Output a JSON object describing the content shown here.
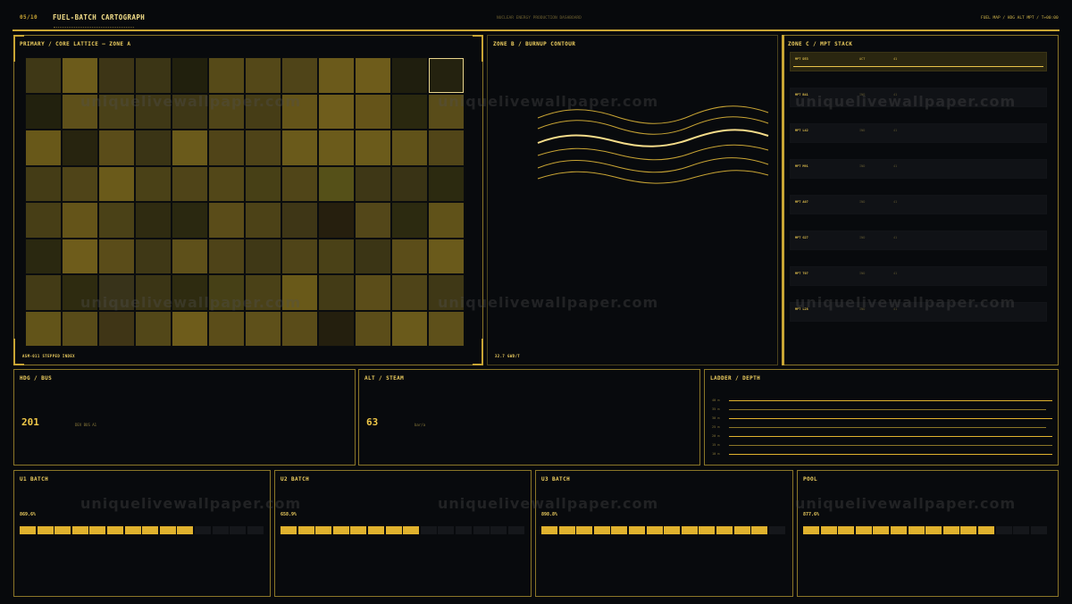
{
  "header": {
    "page_index": "05/10",
    "title": "FUEL-BATCH CARTOGRAPH",
    "subtitle": "NUCLEAR ENERGY PRODUCTION DASHBOARD",
    "right_meta": "FUEL MAP / HDG ALT MPT / T+00:00"
  },
  "zone_a": {
    "title": "PRIMARY / CORE LATTICE — ZONE A",
    "footer": "ASM-011   STEPPED INDEX",
    "cell_shades": [
      "#3f3816",
      "#6c5b1b",
      "#3d3516",
      "#3b3515",
      "#21200d",
      "#564a18",
      "#544818",
      "#4f4418",
      "#6b5a1b",
      "#6e5c1b",
      "#1f1e0e",
      "#24220f",
      "#22210e",
      "#5e501a",
      "#4a4118",
      "#3f3816",
      "#3e3716",
      "#504518",
      "#463d16",
      "#645419",
      "#6f5d1c",
      "#655419",
      "#2a280f",
      "#594c19",
      "#685819",
      "#27240f",
      "#5a4c19",
      "#3a3415",
      "#6a5a1b",
      "#504418",
      "#4e4318",
      "#6a5a1b",
      "#6b5b1b",
      "#6b5b1b",
      "#605219",
      "#514518",
      "#443c16",
      "#4f4418",
      "#6a5a1a",
      "#4a4117",
      "#4f4418",
      "#524718",
      "#474016",
      "#504518",
      "#555018",
      "#3e3716",
      "#393315",
      "#2c2a10",
      "#473e16",
      "#645419",
      "#4a4117",
      "#2f2b11",
      "#2a2810",
      "#5a4c19",
      "#4c4217",
      "#3e3616",
      "#261f0e",
      "#534719",
      "#2c2a10",
      "#605219",
      "#2a2810",
      "#6e5c1b",
      "#5a4c19",
      "#3f3816",
      "#5e501a",
      "#4e4318",
      "#3f3816",
      "#4f4418",
      "#4a4117",
      "#3b3515",
      "#5b4d19",
      "#6a5a1b",
      "#433b16",
      "#2e2b10",
      "#38331a",
      "#3b3515",
      "#2e2b10",
      "#464016",
      "#4a4117",
      "#695919",
      "#433b16",
      "#5b4d19",
      "#4f4418",
      "#3f3816",
      "#625419",
      "#584b19",
      "#3f3516",
      "#524718",
      "#6e5c1b",
      "#5b4d19",
      "#5e501a",
      "#5a4c19",
      "#241f0e",
      "#5b4d19",
      "#6a5a1b",
      "#5e501a"
    ]
  },
  "zone_b": {
    "title": "ZONE B / BURNUP CONTOUR",
    "footer": "32.7 GWd/t"
  },
  "zone_c": {
    "title": "ZONE C / MPT STACK",
    "rows": [
      {
        "name": "MPT D53",
        "status": "ACT",
        "value": "41"
      },
      {
        "name": "MPT B41",
        "status": "IND",
        "value": "41"
      },
      {
        "name": "MPT L42",
        "status": "IND",
        "value": "41"
      },
      {
        "name": "MPT M91",
        "status": "IND",
        "value": "41"
      },
      {
        "name": "MPT A07",
        "status": "IND",
        "value": "41"
      },
      {
        "name": "MPT G27",
        "status": "IND",
        "value": "41"
      },
      {
        "name": "MPT T07",
        "status": "IND",
        "value": "41"
      },
      {
        "name": "MPT L28",
        "status": "IND",
        "value": "41"
      }
    ]
  },
  "hdg": {
    "title": "HDG / BUS",
    "value": "201",
    "unit": "DEV  BUS A1"
  },
  "alt": {
    "title": "ALT / STEAM",
    "value": "63",
    "unit": "bar/a"
  },
  "ladder": {
    "title": "LADDER / DEPTH",
    "ticks": [
      "40 m",
      "35 m",
      "30 m",
      "25 m",
      "20 m",
      "15 m",
      "10 m"
    ],
    "lengths": [
      1.0,
      0.98,
      1.0,
      0.98,
      1.0,
      1.0,
      1.0
    ]
  },
  "batches": [
    {
      "title": "U1 BATCH",
      "pct": "869.6%",
      "filled": 10,
      "total": 14
    },
    {
      "title": "U2 BATCH",
      "pct": "658.9%",
      "filled": 8,
      "total": 14
    },
    {
      "title": "U3 BATCH",
      "pct": "898.8%",
      "filled": 13,
      "total": 14
    },
    {
      "title": "POOL",
      "pct": "877.6%",
      "filled": 11,
      "total": 14
    }
  ],
  "watermark": "uniquelivewallpaper.com"
}
